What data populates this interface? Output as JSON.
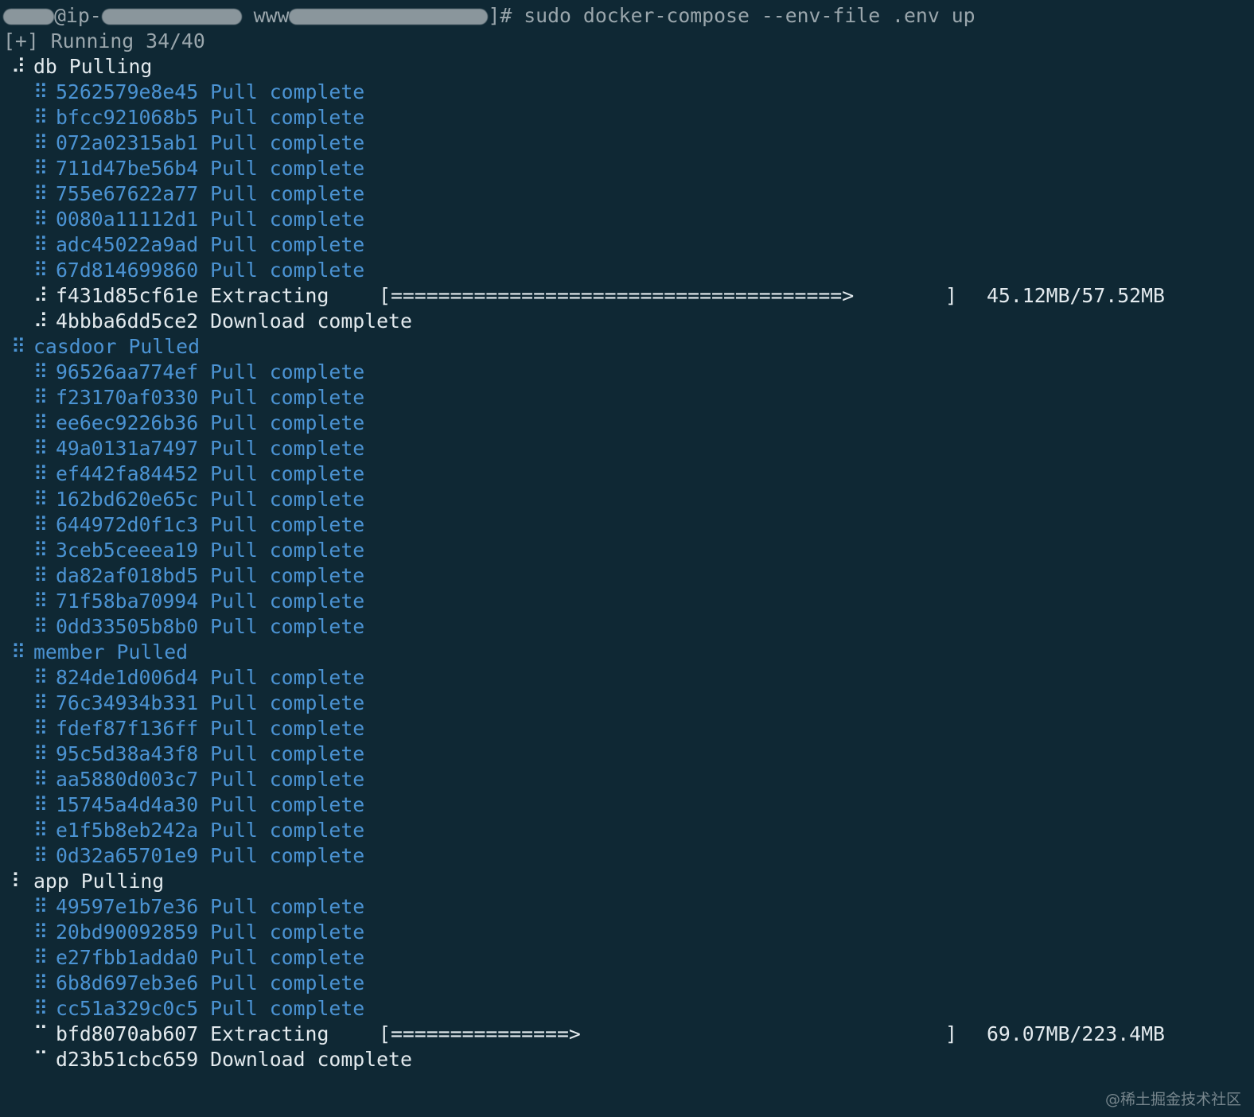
{
  "prompt": {
    "redacted_user": "root",
    "host_prefix": "@ip-",
    "path_prefix": "www",
    "suffix": "]# ",
    "command": "sudo docker-compose --env-file .env up"
  },
  "status_line": "[+] Running 34/40",
  "services": [
    {
      "name": "db",
      "state": "Pulling",
      "spinner": "⠼",
      "color": "#e3eaee",
      "layers": [
        {
          "id": "5262579e8e45",
          "status": "Pull complete",
          "spinner": "⠿",
          "kind": "done"
        },
        {
          "id": "bfcc921068b5",
          "status": "Pull complete",
          "spinner": "⠿",
          "kind": "done"
        },
        {
          "id": "072a02315ab1",
          "status": "Pull complete",
          "spinner": "⠿",
          "kind": "done"
        },
        {
          "id": "711d47be56b4",
          "status": "Pull complete",
          "spinner": "⠿",
          "kind": "done"
        },
        {
          "id": "755e67622a77",
          "status": "Pull complete",
          "spinner": "⠿",
          "kind": "done"
        },
        {
          "id": "0080a11112d1",
          "status": "Pull complete",
          "spinner": "⠿",
          "kind": "done"
        },
        {
          "id": "adc45022a9ad",
          "status": "Pull complete",
          "spinner": "⠿",
          "kind": "done"
        },
        {
          "id": "67d814699860",
          "status": "Pull complete",
          "spinner": "⠿",
          "kind": "done"
        },
        {
          "id": "f431d85cf61e",
          "status": "Extracting",
          "spinner": "⠼",
          "kind": "progress",
          "bar_open": "[",
          "bar_fill": "======================================>",
          "bar_close": "]",
          "progress_fraction": 0.7845,
          "size": "45.12MB/57.52MB"
        },
        {
          "id": "4bbba6dd5ce2",
          "status": "Download complete",
          "spinner": "⠼",
          "kind": "pending"
        }
      ]
    },
    {
      "name": "casdoor",
      "state": "Pulled",
      "spinner": "⠿",
      "color": "#4b93d3",
      "layers": [
        {
          "id": "96526aa774ef",
          "status": "Pull complete",
          "spinner": "⠿",
          "kind": "done"
        },
        {
          "id": "f23170af0330",
          "status": "Pull complete",
          "spinner": "⠿",
          "kind": "done"
        },
        {
          "id": "ee6ec9226b36",
          "status": "Pull complete",
          "spinner": "⠿",
          "kind": "done"
        },
        {
          "id": "49a0131a7497",
          "status": "Pull complete",
          "spinner": "⠿",
          "kind": "done"
        },
        {
          "id": "ef442fa84452",
          "status": "Pull complete",
          "spinner": "⠿",
          "kind": "done"
        },
        {
          "id": "162bd620e65c",
          "status": "Pull complete",
          "spinner": "⠿",
          "kind": "done"
        },
        {
          "id": "644972d0f1c3",
          "status": "Pull complete",
          "spinner": "⠿",
          "kind": "done"
        },
        {
          "id": "3ceb5ceeea19",
          "status": "Pull complete",
          "spinner": "⠿",
          "kind": "done"
        },
        {
          "id": "da82af018bd5",
          "status": "Pull complete",
          "spinner": "⠿",
          "kind": "done"
        },
        {
          "id": "71f58ba70994",
          "status": "Pull complete",
          "spinner": "⠿",
          "kind": "done"
        },
        {
          "id": "0dd33505b8b0",
          "status": "Pull complete",
          "spinner": "⠿",
          "kind": "done"
        }
      ]
    },
    {
      "name": "member",
      "state": "Pulled",
      "spinner": "⠿",
      "color": "#4b93d3",
      "layers": [
        {
          "id": "824de1d006d4",
          "status": "Pull complete",
          "spinner": "⠿",
          "kind": "done"
        },
        {
          "id": "76c34934b331",
          "status": "Pull complete",
          "spinner": "⠿",
          "kind": "done"
        },
        {
          "id": "fdef87f136ff",
          "status": "Pull complete",
          "spinner": "⠿",
          "kind": "done"
        },
        {
          "id": "95c5d38a43f8",
          "status": "Pull complete",
          "spinner": "⠿",
          "kind": "done"
        },
        {
          "id": "aa5880d003c7",
          "status": "Pull complete",
          "spinner": "⠿",
          "kind": "done"
        },
        {
          "id": "15745a4d4a30",
          "status": "Pull complete",
          "spinner": "⠿",
          "kind": "done"
        },
        {
          "id": "e1f5b8eb242a",
          "status": "Pull complete",
          "spinner": "⠿",
          "kind": "done"
        },
        {
          "id": "0d32a65701e9",
          "status": "Pull complete",
          "spinner": "⠿",
          "kind": "done"
        }
      ]
    },
    {
      "name": "app",
      "state": "Pulling",
      "spinner": "⠇",
      "color": "#e3eaee",
      "layers": [
        {
          "id": "49597e1b7e36",
          "status": "Pull complete",
          "spinner": "⠿",
          "kind": "done"
        },
        {
          "id": "20bd90092859",
          "status": "Pull complete",
          "spinner": "⠿",
          "kind": "done"
        },
        {
          "id": "e27fbb1adda0",
          "status": "Pull complete",
          "spinner": "⠿",
          "kind": "done"
        },
        {
          "id": "6b8d697eb3e6",
          "status": "Pull complete",
          "spinner": "⠿",
          "kind": "done"
        },
        {
          "id": "cc51a329c0c5",
          "status": "Pull complete",
          "spinner": "⠿",
          "kind": "done"
        },
        {
          "id": "bfd8070ab607",
          "status": "Extracting",
          "spinner": "⠉",
          "kind": "progress",
          "bar_open": "[",
          "bar_fill": "===============>",
          "bar_close": "]",
          "progress_fraction": 0.3092,
          "size": "69.07MB/223.4MB"
        },
        {
          "id": "d23b51cbc659",
          "status": "Download complete",
          "spinner": "⠉",
          "kind": "pending"
        }
      ]
    }
  ],
  "watermark": "@稀土掘金技术社区",
  "colors": {
    "background": "#0f2834",
    "text_default": "#d4dee3",
    "text_gray": "#9aa6ac",
    "done_blue": "#4b93d3",
    "active_white": "#e3eaee"
  }
}
